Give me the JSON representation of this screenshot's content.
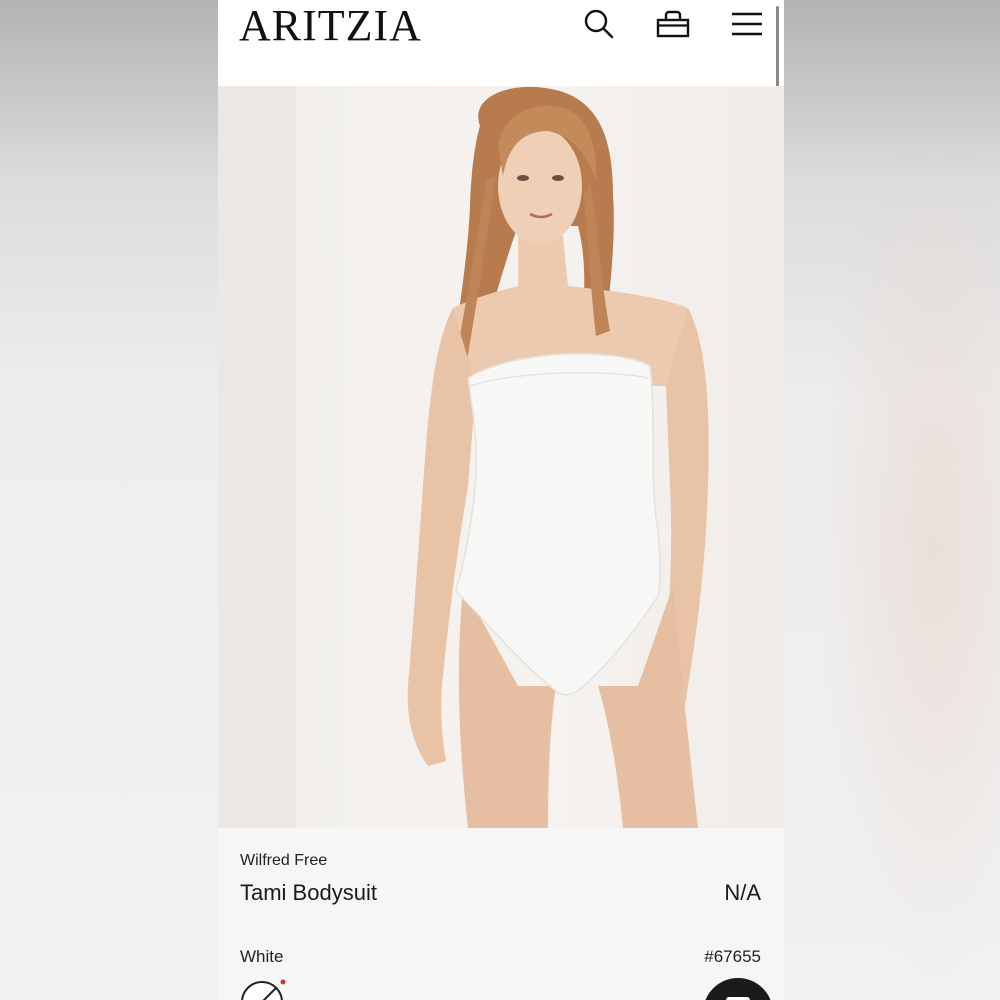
{
  "header": {
    "logo_text": "ARITZIA",
    "icons": [
      "search-icon",
      "bag-icon",
      "menu-icon"
    ]
  },
  "product": {
    "brand": "Wilfred Free",
    "name": "Tami Bodysuit",
    "price": "N/A",
    "color": "White",
    "style_number": "#67655",
    "image_subject": "model wearing white strapless bodysuit"
  },
  "colors": {
    "background": "#ffffff",
    "text": "#1a1a1a",
    "details_bg": "#f6f6f6",
    "swatch_dot": "#d32f2f",
    "chat_button": "#1b1b1b"
  }
}
